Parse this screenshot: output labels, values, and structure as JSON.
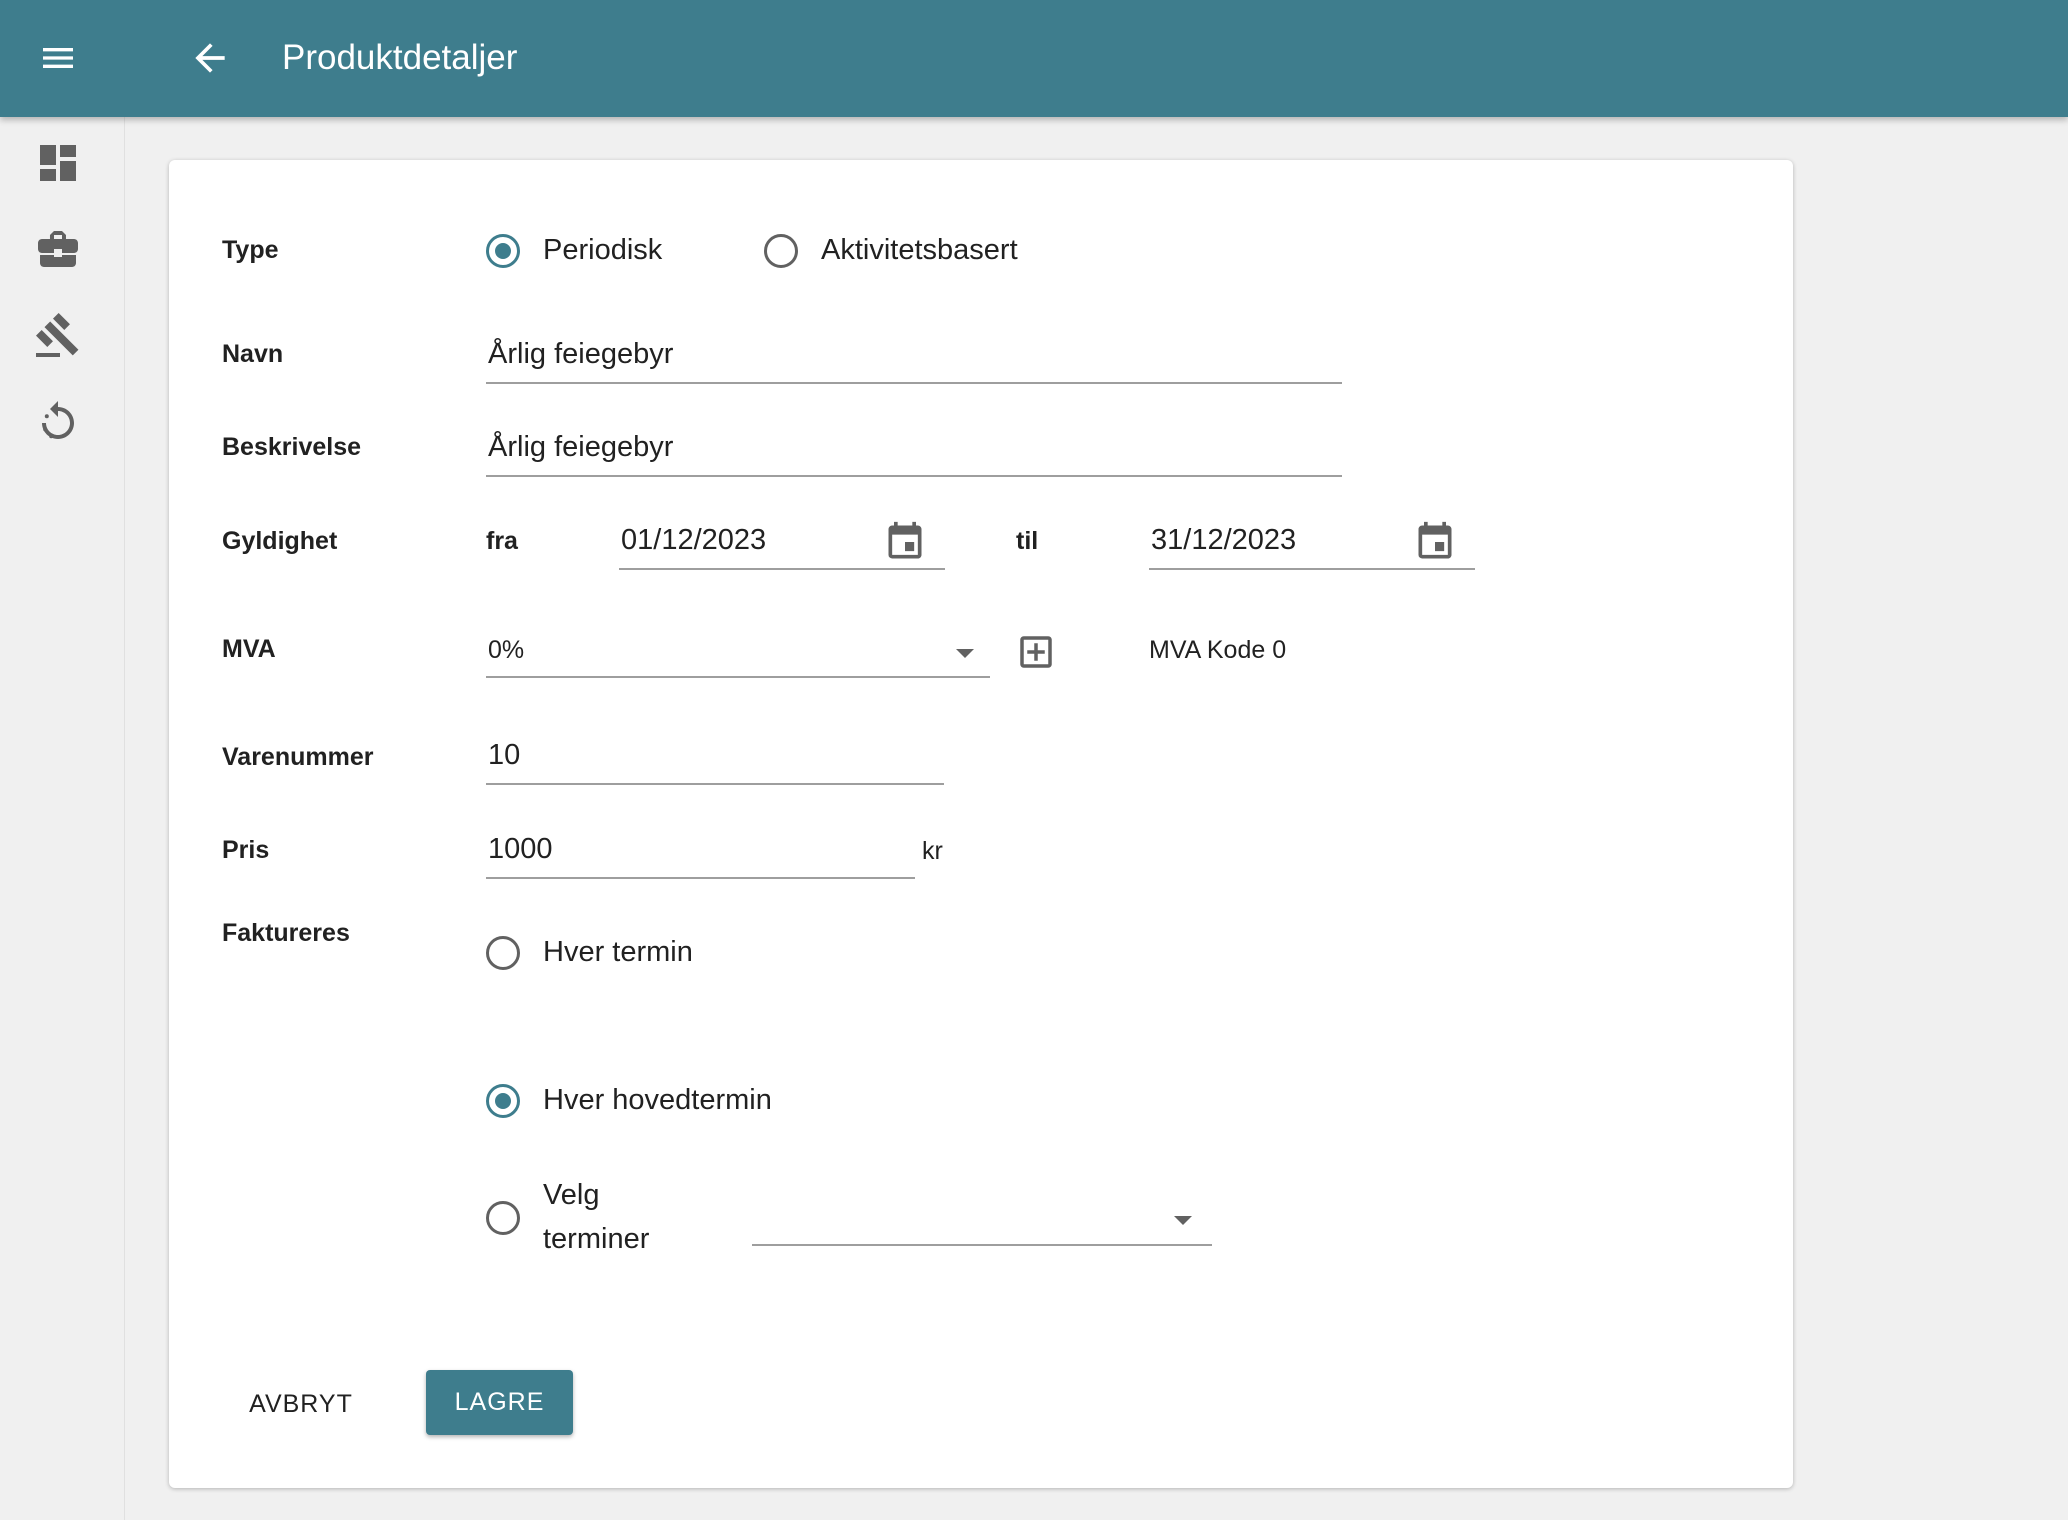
{
  "header": {
    "title": "Produktdetaljer",
    "menu_icon": "menu-icon",
    "back_icon": "arrow-left-icon"
  },
  "sidebar": {
    "items": [
      {
        "icon": "dashboard-icon"
      },
      {
        "icon": "briefcase-icon"
      },
      {
        "icon": "gavel-icon"
      },
      {
        "icon": "history-icon"
      }
    ]
  },
  "form": {
    "type": {
      "label": "Type",
      "options": [
        "Periodisk",
        "Aktivitetsbasert"
      ],
      "selected": "Periodisk"
    },
    "navn": {
      "label": "Navn",
      "value": "Årlig feiegebyr"
    },
    "beskrivelse": {
      "label": "Beskrivelse",
      "value": "Årlig feiegebyr"
    },
    "gyldighet": {
      "label": "Gyldighet",
      "from_label": "fra",
      "from_value": "01/12/2023",
      "to_label": "til",
      "to_value": "31/12/2023"
    },
    "mva": {
      "label": "MVA",
      "value": "0%",
      "code": "MVA Kode 0"
    },
    "varenummer": {
      "label": "Varenummer",
      "value": "10"
    },
    "pris": {
      "label": "Pris",
      "value": "1000",
      "unit": "kr"
    },
    "faktureres": {
      "label": "Faktureres",
      "options": [
        "Hver termin",
        "Hver hovedtermin",
        "Velg",
        "terminer"
      ],
      "selected": "Hver hovedtermin"
    }
  },
  "actions": {
    "cancel": "AVBRYT",
    "save": "LAGRE"
  },
  "colors": {
    "primary": "#3e7d8d",
    "background": "#f0f0f0"
  }
}
